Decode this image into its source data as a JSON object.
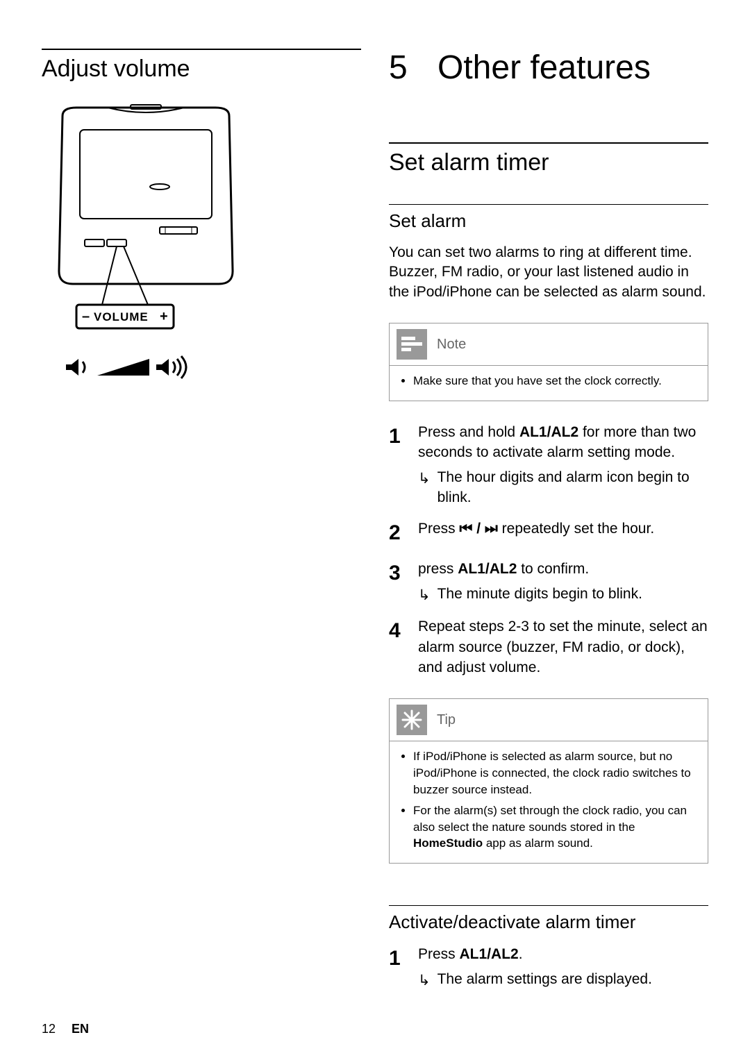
{
  "left": {
    "title": "Adjust volume",
    "volume_button_label": "VOLUME"
  },
  "right": {
    "chapter_number": "5",
    "chapter_title": "Other features",
    "section_title": "Set alarm timer",
    "set_alarm": {
      "heading": "Set alarm",
      "intro": "You can set two alarms to ring at different time. Buzzer, FM radio, or your last listened audio in the iPod/iPhone can be selected as alarm sound.",
      "note": {
        "label": "Note",
        "items": [
          "Make sure that you have set the clock correctly."
        ]
      },
      "steps": [
        {
          "n": "1",
          "text_pre": "Press and hold ",
          "text_bold": "AL1/AL2",
          "text_post": " for more than two seconds to activate alarm setting mode.",
          "result": "The hour digits and alarm icon begin to blink."
        },
        {
          "n": "2",
          "text_pre": "Press ",
          "glyph": "⏮ / ⏭",
          "text_post": " repeatedly set the hour."
        },
        {
          "n": "3",
          "text_pre": "press ",
          "text_bold": "AL1/AL2",
          "text_post": " to confirm.",
          "result": "The minute digits begin to blink."
        },
        {
          "n": "4",
          "text_pre": "Repeat steps 2-3 to set the minute, select an alarm source (buzzer, FM radio, or dock), and adjust volume."
        }
      ],
      "tip": {
        "label": "Tip",
        "items": [
          {
            "pre": "If iPod/iPhone is selected as alarm source, but no iPod/iPhone is connected, the clock radio switches to buzzer source instead."
          },
          {
            "pre": "For the alarm(s) set through the clock radio, you can also select the nature sounds stored in the ",
            "bold": "HomeStudio",
            "post": " app as alarm sound."
          }
        ]
      }
    },
    "activate": {
      "heading": "Activate/deactivate alarm timer",
      "steps": [
        {
          "n": "1",
          "text_pre": "Press ",
          "text_bold": "AL1/AL2",
          "text_post": ".",
          "result": "The alarm settings are displayed."
        }
      ]
    }
  },
  "footer": {
    "page": "12",
    "lang": "EN"
  }
}
